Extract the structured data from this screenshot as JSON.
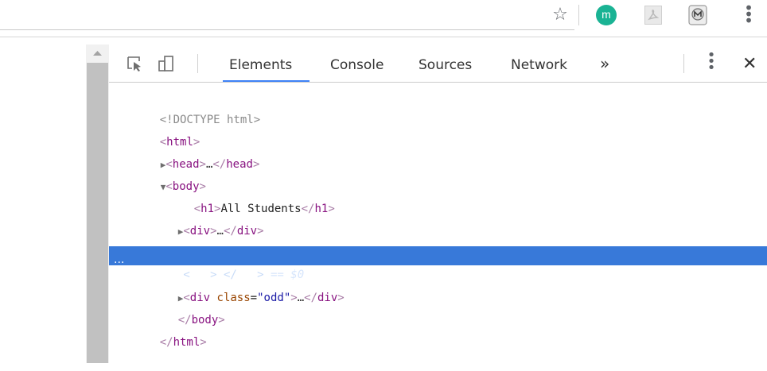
{
  "browser": {
    "star_icon": "star-icon",
    "extensions": [
      {
        "name": "extension-m-icon",
        "label": "m",
        "color": "#1ab394"
      },
      {
        "name": "pdf-extension-icon"
      },
      {
        "name": "shield-extension-icon"
      }
    ],
    "menu_icon": "kebab-menu-icon"
  },
  "devtools": {
    "tabs": [
      {
        "label": "Elements",
        "active": true
      },
      {
        "label": "Console"
      },
      {
        "label": "Sources"
      },
      {
        "label": "Network"
      }
    ],
    "more_tabs": "»",
    "close": "✕",
    "accent": "#3e82f7",
    "selection_color": "#3879d9",
    "tree": {
      "doctype": "<!DOCTYPE html>",
      "html_open": "html",
      "head": "head",
      "body": "body",
      "h1_tag": "h1",
      "h1_text": "All Students",
      "div": "div",
      "class_attr": "class",
      "class_val": "\"odd\"",
      "ellipsis": "…",
      "selected_marker": "== $0",
      "gutter_dots": "···"
    }
  }
}
